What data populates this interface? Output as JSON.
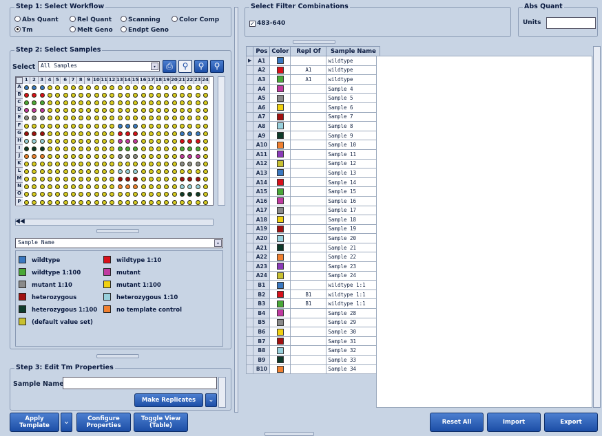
{
  "step1": {
    "title": "Step 1: Select Workflow",
    "options": [
      "Abs Quant",
      "Rel Quant",
      "Scanning",
      "Color Comp",
      "Tm",
      "Melt Geno",
      "Endpt Geno"
    ],
    "selected": "Tm"
  },
  "filter": {
    "title": "Select Filter Combinations",
    "combo": "483-640",
    "checked": true
  },
  "absquant": {
    "title": "Abs Quant",
    "units_label": "Units",
    "units_value": ""
  },
  "step2": {
    "title": "Step 2: Select Samples",
    "select_label": "Select",
    "select_value": "All Samples",
    "col_headers": [
      "1",
      "2",
      "3",
      "4",
      "5",
      "6",
      "7",
      "8",
      "9",
      "10",
      "11",
      "12",
      "13",
      "14",
      "15",
      "16",
      "17",
      "18",
      "19",
      "20",
      "21",
      "22",
      "23",
      "24"
    ],
    "row_headers": [
      "A",
      "B",
      "C",
      "D",
      "E",
      "F",
      "G",
      "H",
      "I",
      "J",
      "K",
      "L",
      "M",
      "N",
      "O",
      "P"
    ],
    "legend_dropdown": "Sample Name",
    "legend": [
      {
        "label": "wildtype",
        "color": "#3a78c0"
      },
      {
        "label": "wildtype 1:10",
        "color": "#d8101a"
      },
      {
        "label": "wildtype 1:100",
        "color": "#4aa838"
      },
      {
        "label": "mutant",
        "color": "#c03aa0"
      },
      {
        "label": "mutant 1:10",
        "color": "#8a8a8a"
      },
      {
        "label": "mutant 1:100",
        "color": "#f0d010"
      },
      {
        "label": "heterozygous",
        "color": "#a01010"
      },
      {
        "label": "heterozygous 1:10",
        "color": "#98d0dc"
      },
      {
        "label": "heterozygous 1:100",
        "color": "#0e3a2a"
      },
      {
        "label": "no template control",
        "color": "#f08030"
      },
      {
        "label": "(default value set)",
        "color": "#c8c030"
      }
    ]
  },
  "step3": {
    "title": "Step 3: Edit Tm Properties",
    "sample_name_label": "Sample Name",
    "sample_name_value": "",
    "make_replicates": "Make Replicates"
  },
  "table": {
    "headers": [
      "Pos",
      "Color",
      "Repl Of",
      "Sample Name"
    ],
    "rows": [
      {
        "pos": "A1",
        "color": "#3a78c0",
        "repl": "",
        "name": "wildtype"
      },
      {
        "pos": "A2",
        "color": "#d8101a",
        "repl": "A1",
        "name": "wildtype"
      },
      {
        "pos": "A3",
        "color": "#4aa838",
        "repl": "A1",
        "name": "wildtype"
      },
      {
        "pos": "A4",
        "color": "#c03aa0",
        "repl": "",
        "name": "Sample 4"
      },
      {
        "pos": "A5",
        "color": "#8a8a8a",
        "repl": "",
        "name": "Sample 5"
      },
      {
        "pos": "A6",
        "color": "#f0d010",
        "repl": "",
        "name": "Sample 6"
      },
      {
        "pos": "A7",
        "color": "#a01010",
        "repl": "",
        "name": "Sample 7"
      },
      {
        "pos": "A8",
        "color": "#98d0dc",
        "repl": "",
        "name": "Sample 8"
      },
      {
        "pos": "A9",
        "color": "#0e3a2a",
        "repl": "",
        "name": "Sample 9"
      },
      {
        "pos": "A10",
        "color": "#f08030",
        "repl": "",
        "name": "Sample 10"
      },
      {
        "pos": "A11",
        "color": "#8a3ab8",
        "repl": "",
        "name": "Sample 11"
      },
      {
        "pos": "A12",
        "color": "#c8c030",
        "repl": "",
        "name": "Sample 12"
      },
      {
        "pos": "A13",
        "color": "#3a78c0",
        "repl": "",
        "name": "Sample 13"
      },
      {
        "pos": "A14",
        "color": "#d8101a",
        "repl": "",
        "name": "Sample 14"
      },
      {
        "pos": "A15",
        "color": "#4aa838",
        "repl": "",
        "name": "Sample 15"
      },
      {
        "pos": "A16",
        "color": "#c03aa0",
        "repl": "",
        "name": "Sample 16"
      },
      {
        "pos": "A17",
        "color": "#8a8a8a",
        "repl": "",
        "name": "Sample 17"
      },
      {
        "pos": "A18",
        "color": "#f0d010",
        "repl": "",
        "name": "Sample 18"
      },
      {
        "pos": "A19",
        "color": "#a01010",
        "repl": "",
        "name": "Sample 19"
      },
      {
        "pos": "A20",
        "color": "#98d0dc",
        "repl": "",
        "name": "Sample 20"
      },
      {
        "pos": "A21",
        "color": "#0e3a2a",
        "repl": "",
        "name": "Sample 21"
      },
      {
        "pos": "A22",
        "color": "#f08030",
        "repl": "",
        "name": "Sample 22"
      },
      {
        "pos": "A23",
        "color": "#8a3ab8",
        "repl": "",
        "name": "Sample 23"
      },
      {
        "pos": "A24",
        "color": "#c8c030",
        "repl": "",
        "name": "Sample 24"
      },
      {
        "pos": "B1",
        "color": "#3a78c0",
        "repl": "",
        "name": "wildtype 1:1"
      },
      {
        "pos": "B2",
        "color": "#d8101a",
        "repl": "B1",
        "name": "wildtype 1:1"
      },
      {
        "pos": "B3",
        "color": "#4aa838",
        "repl": "B1",
        "name": "wildtype 1:1"
      },
      {
        "pos": "B4",
        "color": "#c03aa0",
        "repl": "",
        "name": "Sample 28"
      },
      {
        "pos": "B5",
        "color": "#8a8a8a",
        "repl": "",
        "name": "Sample 29"
      },
      {
        "pos": "B6",
        "color": "#f0d010",
        "repl": "",
        "name": "Sample 30"
      },
      {
        "pos": "B7",
        "color": "#a01010",
        "repl": "",
        "name": "Sample 31"
      },
      {
        "pos": "B8",
        "color": "#98d0dc",
        "repl": "",
        "name": "Sample 32"
      },
      {
        "pos": "B9",
        "color": "#0e3a2a",
        "repl": "",
        "name": "Sample 33"
      },
      {
        "pos": "B10",
        "color": "#f08030",
        "repl": "",
        "name": "Sample 34"
      }
    ]
  },
  "buttons": {
    "apply_template": "Apply Template",
    "configure_properties": "Configure Properties",
    "toggle_view": "Toggle View (Table)",
    "reset_all": "Reset All",
    "import": "Import",
    "export": "Export"
  },
  "plate_wells": {
    "rows": [
      "BBBYYYYYYYYYYYYYYYYYYYYY",
      "RRRYYYYYYYYYYYYYYYYYYYYY",
      "GGGYYYYYYYYYYYYYYYYYYYYY",
      "MMMYYYYYYYYYYYYYYYYYYYYY",
      "AAAYYYYYYYYYYYYYYYYYYYYY",
      "YYYYYYYYYYYYBBBYYYYYYYYY",
      "HHHYYYYYYYYYRRRYYYYYBBBY",
      "CCCYYYYYYYYYMMMYYYYYRRRY",
      "DDDYYYYYYYYYGGGYYYYYGGGY",
      "OOOYYYYYYYYYAAAYYYYYMMMY",
      "YYYYYYYYYYYYYYYYYYYYAAAY",
      "YYYYYYYYYYYYCCCYYYYYYYYY",
      "YYYYYYYYYYYYHHHYYYYYHHHY",
      "YYYYYYYYYYYYOOOYYYYYCCCY",
      "YYYYYYYYYYYYYYYYYYYYDDDY",
      "YYYYYYYYYYYYYYYYYYYYYYYY"
    ],
    "colors": {
      "B": "#3a78c0",
      "R": "#d8101a",
      "G": "#4aa838",
      "M": "#c03aa0",
      "A": "#8a8a8a",
      "Y": "#d8cc20",
      "H": "#a01010",
      "C": "#98d0dc",
      "D": "#0e3a2a",
      "O": "#f08030"
    }
  }
}
